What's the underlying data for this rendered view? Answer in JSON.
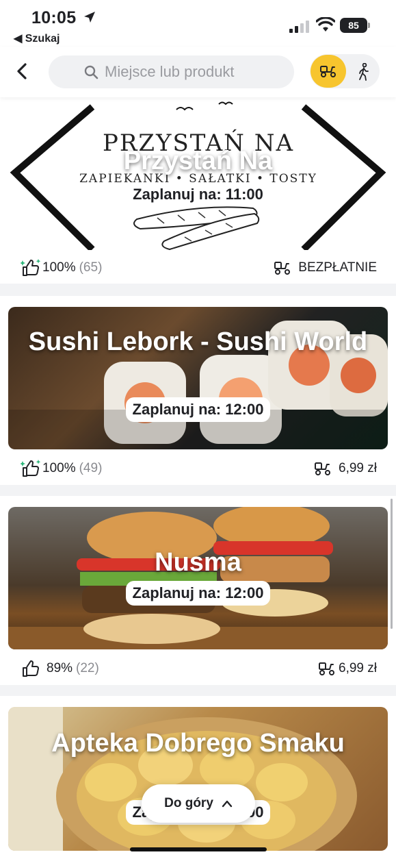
{
  "status_bar": {
    "time": "10:05",
    "back_app": "◀ Szukaj",
    "battery": "85"
  },
  "header": {
    "search_placeholder": "Miejsce lub produkt"
  },
  "restaurants": [
    {
      "name": "Przystań Na",
      "schedule": "Zaplanuj na: 11:00",
      "rating": "100%",
      "rating_count": "(65)",
      "delivery_fee": "BEZPŁATNIE",
      "logo_title": "PRZYSTAŃ NA",
      "logo_subtitle": "ZAPIEKANKI • SAŁATKI • TOSTY"
    },
    {
      "name": "Sushi Lebork - Sushi World",
      "schedule": "Zaplanuj na: 12:00",
      "rating": "100%",
      "rating_count": "(49)",
      "delivery_fee": "6,99 zł"
    },
    {
      "name": "Nusma",
      "schedule": "Zaplanuj na: 12:00",
      "rating": "89%",
      "rating_count": "(22)",
      "delivery_fee": "6,99 zł"
    },
    {
      "name": "Apteka Dobrego Smaku",
      "schedule": "Zaplanuj na: 12:00"
    }
  ],
  "to_top_label": "Do góry",
  "colors": {
    "accent": "#f7c52e",
    "text": "#202125",
    "muted": "#8a8b90",
    "rating_green": "#2fb67c"
  }
}
